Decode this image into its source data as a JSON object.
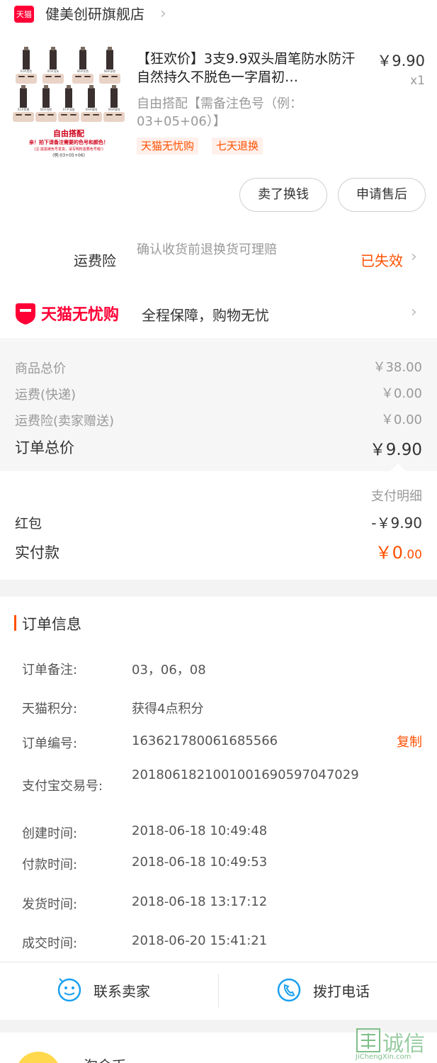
{
  "store": {
    "badge": "天猫",
    "name": "健美创研旗舰店",
    "chevron": "›"
  },
  "product": {
    "title": "【狂欢价】3支9.9双头眉笔防水防汗自然持久不脱色一字眉初…",
    "price": "￥9.90",
    "qty": "x1",
    "sku": "自由搭配【需备注色号（例：03+05+06）】",
    "tags": [
      "天猫无忧购",
      "七天退换"
    ],
    "image": {
      "shade_labels": [
        "03#黑色",
        "05#浅灰",
        "06#灰色",
        "08#深棕",
        "01#黑褐",
        "04#浅棕",
        "07#浅咖",
        "09#咖啡",
        "09#咖啡"
      ],
      "promo_title": "自由搭配",
      "promo_line1": "亲！拍下请备注需要的色号和颜色！",
      "promo_line2": "(注:需需被色号发货，请写明所需要色号喔!)",
      "promo_line3": "(例:03+05+06)"
    }
  },
  "actions": {
    "sell": "卖了换钱",
    "after_sale": "申请售后"
  },
  "insurance": {
    "label": "运费险",
    "desc": "确认收货前退换货可理赔",
    "status": "已失效",
    "chevron": "›"
  },
  "guarantee": {
    "brand": "天猫无忧购",
    "text": "全程保障，购物无忧",
    "chevron": "›"
  },
  "summary": {
    "rows": [
      {
        "label": "商品总价",
        "value": "￥38.00"
      },
      {
        "label": "运费(快递)",
        "value": "￥0.00"
      },
      {
        "label": "运费险(卖家赠送)",
        "value": "￥0.00"
      }
    ],
    "total_label": "订单总价",
    "total_value": "￥9.90"
  },
  "payment": {
    "detail_link": "支付明细",
    "red_packet_label": "红包",
    "red_packet_value": "-￥9.90",
    "paid_label": "实付款",
    "paid_value_main": "￥0",
    "paid_value_dec": ".00"
  },
  "order_info": {
    "title": "订单信息",
    "rows": [
      {
        "key": "订单备注:",
        "value": "03，06，08"
      },
      {
        "key": "天猫积分:",
        "value": "获得4点积分"
      },
      {
        "key": "订单编号:",
        "value": "163621780061685566"
      },
      {
        "key": "支付宝交易号:",
        "value": "20180618210010016905970470​29"
      },
      {
        "key": "创建时间:",
        "value": "2018-06-18 10:49:48"
      },
      {
        "key": "付款时间:",
        "value": "2018-06-18 10:49:53"
      },
      {
        "key": "发货时间:",
        "value": "2018-06-18 13:17:12"
      },
      {
        "key": "成交时间:",
        "value": "2018-06-20 15:41:21"
      }
    ],
    "copy": "复制"
  },
  "bottom": {
    "contact": "联系卖家",
    "call": "拨打电话"
  },
  "ad": {
    "name": "淘金币"
  },
  "watermark": {
    "text": "诚信",
    "sub": "JiChengXin.com"
  },
  "colors": {
    "accent": "#ff5000",
    "tmall_red": "#ff0036",
    "icon_blue": "#1aa0f0"
  }
}
